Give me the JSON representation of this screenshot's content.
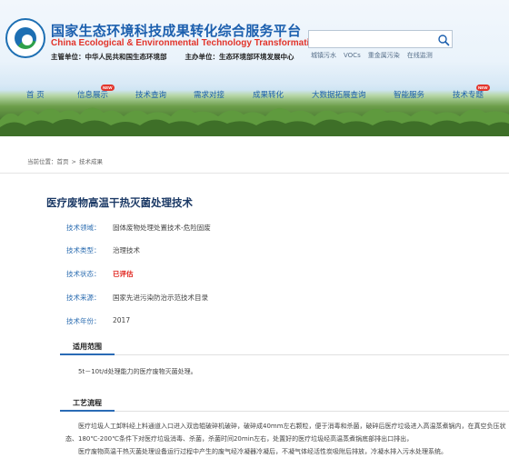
{
  "header": {
    "title_cn": "国家生态环境科技成果转化综合服务平台",
    "title_en": "China Ecological & Environmental Technology Transformation",
    "sponsor_label": "主管单位：",
    "sponsor": "中华人民共和国生态环境部",
    "organizer_label": "主办单位：",
    "organizer": "生态环境部环境发展中心",
    "search_placeholder": "",
    "hotwords": [
      "城镇污水",
      "VOCs",
      "重金属污染",
      "在线监测"
    ]
  },
  "nav": [
    {
      "label": "首  页",
      "badge": ""
    },
    {
      "label": "信息展示",
      "badge": "NEW"
    },
    {
      "label": "技术查询",
      "badge": ""
    },
    {
      "label": "需求对接",
      "badge": ""
    },
    {
      "label": "成果转化",
      "badge": ""
    },
    {
      "label": "大数据拓展查询",
      "badge": ""
    },
    {
      "label": "智能服务",
      "badge": ""
    },
    {
      "label": "技术专题",
      "badge": "NEW"
    }
  ],
  "breadcrumb": {
    "prefix": "当前位置：",
    "items": [
      "首页",
      "技术成果"
    ]
  },
  "article": {
    "title": "医疗废物高温干热灭菌处理技术",
    "meta": [
      {
        "label": "技术领域：",
        "value": "固体废物处理处置技术-危险固废"
      },
      {
        "label": "技术类型：",
        "value": "治理技术"
      },
      {
        "label": "技术状态：",
        "value": "已评估"
      },
      {
        "label": "技术来源：",
        "value": "国家先进污染防治示范技术目录"
      },
      {
        "label": "技术年份：",
        "value": "2017"
      }
    ],
    "section1_title": "适用范围",
    "section1_text": "5t－10t/d处理能力的医疗废物灭菌处理。",
    "section2_title": "工艺流程",
    "section2_p1": "医疗垃圾人工卸料经上料通道入口进入双齿辊破碎机破碎，破碎成40mm左右颗粒，便于消毒和杀菌，破碎后医疗垃圾进入高温蒸煮锅内，在真空负压状态、180℃-200℃条件下对医疗垃圾消毒、杀菌，杀菌时间20min左右，处置好的医疗垃圾经高温蒸煮锅底部排出口排出，",
    "section2_p2": "医疗废物高温干热灭菌处理设备运行过程中产生的废气经冷凝器冷凝后，不凝气体经活性炭吸附后排放，冷凝水排入污水处理系统。"
  },
  "colors": {
    "brand_blue": "#1b5fae",
    "accent_red": "#e0261f"
  }
}
